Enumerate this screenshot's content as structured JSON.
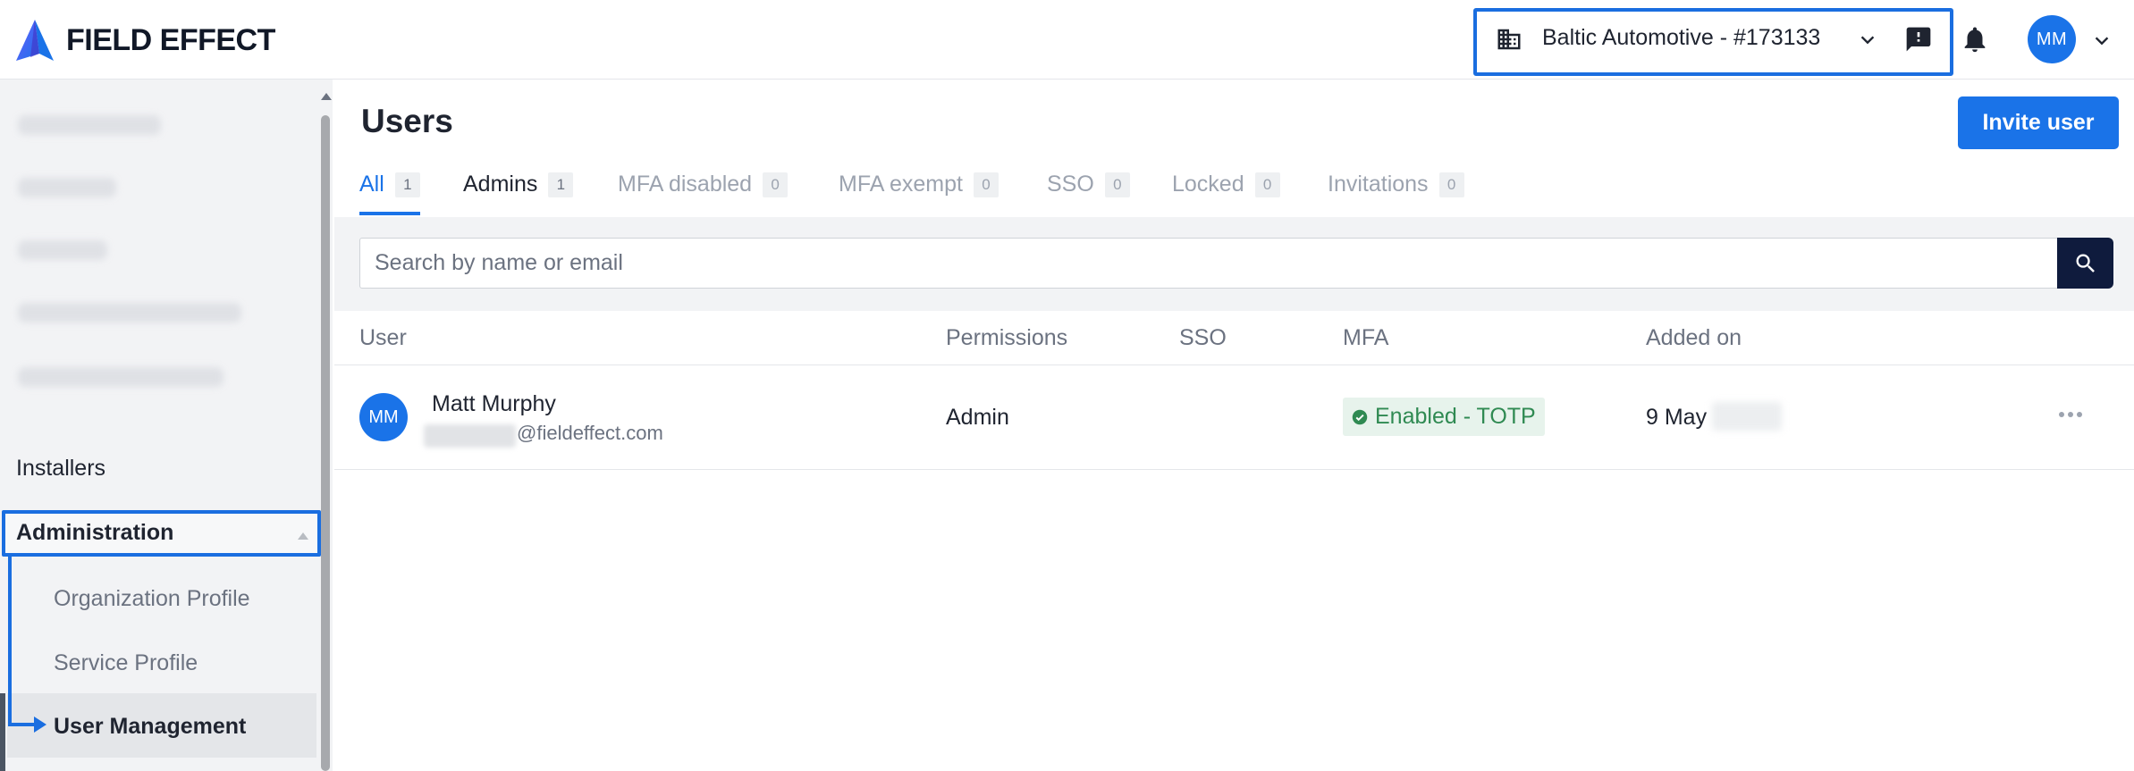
{
  "brand": {
    "name": "FIELD EFFECT"
  },
  "header": {
    "org_name": "Baltic Automotive - #173133",
    "user_initials": "MM",
    "icons": [
      "building-icon",
      "chevron-down-icon",
      "feedback-icon",
      "bell-icon",
      "chevron-down-icon"
    ]
  },
  "sidebar": {
    "items": [
      {
        "label": "Installers"
      },
      {
        "label": "Administration"
      }
    ],
    "admin_children": [
      {
        "label": "Organization Profile"
      },
      {
        "label": "Service Profile"
      },
      {
        "label": "User Management"
      }
    ]
  },
  "main": {
    "title": "Users",
    "invite_label": "Invite user",
    "tabs": [
      {
        "label": "All",
        "count": "1"
      },
      {
        "label": "Admins",
        "count": "1"
      },
      {
        "label": "MFA disabled",
        "count": "0"
      },
      {
        "label": "MFA exempt",
        "count": "0"
      },
      {
        "label": "SSO",
        "count": "0"
      },
      {
        "label": "Locked",
        "count": "0"
      },
      {
        "label": "Invitations",
        "count": "0"
      }
    ],
    "search": {
      "placeholder": "Search by name or email"
    },
    "columns": [
      "User",
      "Permissions",
      "SSO",
      "MFA",
      "Added on"
    ],
    "rows": [
      {
        "initials": "MM",
        "name": "Matt Murphy",
        "email_domain": "@fieldeffect.com",
        "permissions": "Admin",
        "sso": "",
        "mfa": "Enabled - TOTP",
        "added_on": "9 May"
      }
    ]
  },
  "colors": {
    "accent": "#1a73e8",
    "annotation": "#1a6ee0",
    "search_button": "#0f1b3d",
    "mfa_enabled_bg": "#e7f3ec",
    "mfa_enabled_text": "#2f8a52"
  }
}
